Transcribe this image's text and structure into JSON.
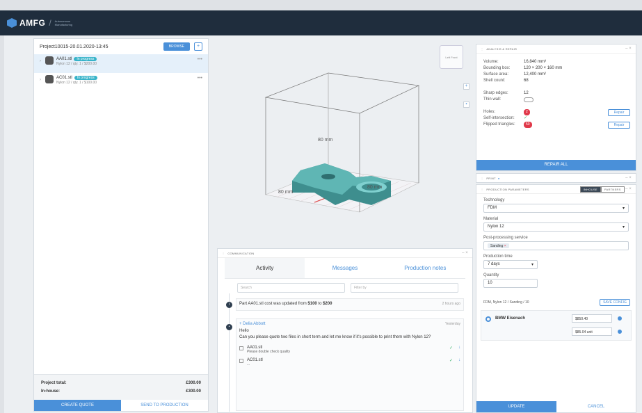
{
  "app": {
    "brand": "AMFG",
    "tagline": "Autonomous Manufacturing"
  },
  "project": {
    "title": "Project10015-20.01.2020-13:45",
    "browse_label": "BROWSE",
    "add_label": "+",
    "files": [
      {
        "name": "AA01.stl",
        "status": "In progress",
        "sub": "Nylon 12 / qty. 1 / $200.00",
        "selected": true
      },
      {
        "name": "AC01.stl",
        "status": "In progress",
        "sub": "Nylon 12 / qty. 1 / $100.00",
        "selected": false
      }
    ],
    "totals": [
      {
        "label": "Project total:",
        "value": "£300.00"
      },
      {
        "label": "In-house:",
        "value": "£300.00"
      }
    ],
    "create_quote": "CREATE QUOTE",
    "send_to_production": "SEND TO PRODUCTION"
  },
  "viewer": {
    "dim_height": "80 mm",
    "dim_width": "80 mm",
    "dim_depth": "80 mm",
    "cube_labels": [
      "Left",
      "Front"
    ]
  },
  "communication": {
    "header": "COMMUNICATION",
    "tabs": [
      "Activity",
      "Messages",
      "Production notes"
    ],
    "search_placeholder": "Search",
    "filter_placeholder": "Filter by",
    "update": {
      "text_prefix": "Part AA01.stl cost was updated from ",
      "from": "$100",
      "to_word": " to ",
      "to": "$200",
      "time": "2 hours ago"
    },
    "message": {
      "author": "+ Delia Abbott",
      "time": "Yesterday",
      "greeting": "Hello",
      "body": "Can you please quote two files in short term and let me know if it's possible to print them with Nylon 12?",
      "items": [
        {
          "name": "AA01.stl",
          "note": "Please double check quality"
        },
        {
          "name": "AC01.stl",
          "note": "..."
        }
      ]
    }
  },
  "analysis": {
    "header": "ANALYSIS & REPAIR",
    "rows": [
      {
        "k": "Volume:",
        "v": "16,840 mm³"
      },
      {
        "k": "Bounding box:",
        "v": "120 × 200 × 160 mm"
      },
      {
        "k": "Surface area:",
        "v": "12,400 mm²"
      },
      {
        "k": "Shell count:",
        "v": "68"
      }
    ],
    "sharp_edges": {
      "k": "Sharp edges:",
      "v": "12"
    },
    "thin_wall": {
      "k": "Thin wall:"
    },
    "holes": {
      "k": "Holes:",
      "v": "2"
    },
    "self_intersection": {
      "k": "Self-intersection:",
      "v": "✓"
    },
    "flipped": {
      "k": "Flipped triangles:",
      "v": "50"
    },
    "repair_label": "Repair",
    "repair_all": "REPAIR ALL"
  },
  "print_panel": {
    "header": "PRINT"
  },
  "production": {
    "header": "PRODUCTION PARAMETERS",
    "seg": [
      "INHOUSE",
      "PARTNERS"
    ],
    "technology_label": "Technology",
    "technology": "FDM",
    "material_label": "Material",
    "material": "Nylon 12",
    "post_label": "Post-processing service",
    "post_chip": "Sanding",
    "time_label": "Production time",
    "time": "7 days",
    "qty_label": "Quantity",
    "qty": "10",
    "summary": "FDM, Nylon 12 / Sanding / 10",
    "save_label": "SAVE CONFIG",
    "vendor": "BMW Eisenach",
    "price1": "$850.40",
    "price2": "$85.04 unit",
    "update": "UPDATE",
    "cancel": "CANCEL"
  }
}
